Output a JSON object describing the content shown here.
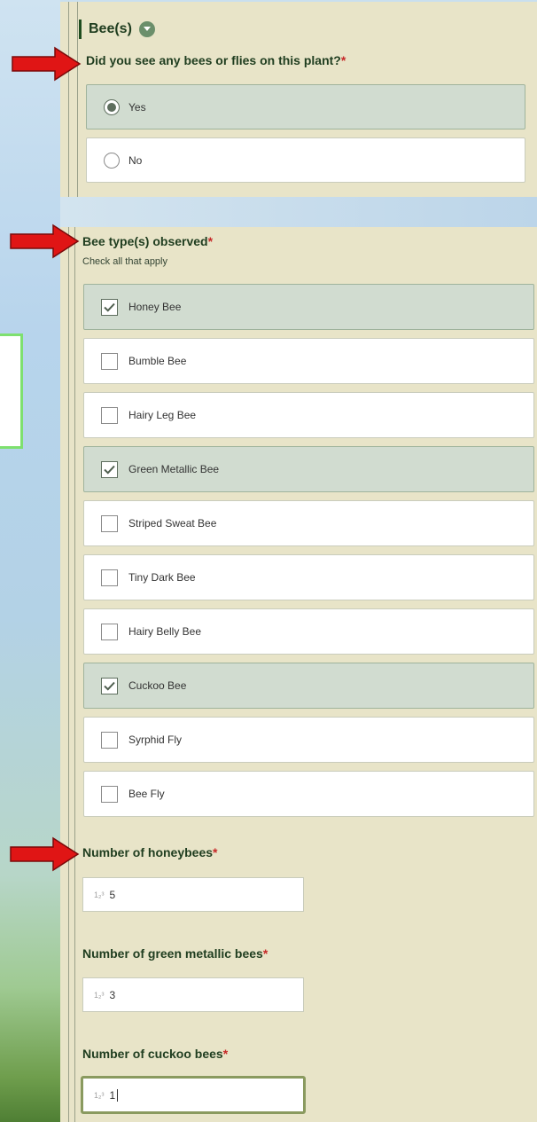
{
  "section": {
    "title": "Bee(s)"
  },
  "q1": {
    "label": "Did you see any bees or flies on this plant?",
    "required_mark": "*",
    "options": [
      {
        "label": "Yes",
        "selected": true
      },
      {
        "label": "No",
        "selected": false
      }
    ]
  },
  "q2": {
    "label": "Bee type(s) observed",
    "required_mark": "*",
    "hint": "Check all that apply",
    "options": [
      {
        "label": "Honey Bee",
        "checked": true
      },
      {
        "label": "Bumble Bee",
        "checked": false
      },
      {
        "label": "Hairy Leg Bee",
        "checked": false
      },
      {
        "label": "Green Metallic Bee",
        "checked": true
      },
      {
        "label": "Striped Sweat Bee",
        "checked": false
      },
      {
        "label": "Tiny Dark Bee",
        "checked": false
      },
      {
        "label": "Hairy Belly Bee",
        "checked": false
      },
      {
        "label": "Cuckoo Bee",
        "checked": true
      },
      {
        "label": "Syrphid Fly",
        "checked": false
      },
      {
        "label": "Bee Fly",
        "checked": false
      }
    ]
  },
  "counts": [
    {
      "label": "Number of honeybees",
      "required_mark": "*",
      "value": "5"
    },
    {
      "label": "Number of green metallic bees",
      "required_mark": "*",
      "value": "3"
    },
    {
      "label": "Number of cuckoo bees",
      "required_mark": "*",
      "value": "1"
    }
  ],
  "number_icon": "1₂³",
  "colors": {
    "accent": "#1f3d1f",
    "required": "#c62828",
    "selected_bg": "#d1dcd0",
    "arrow": "#e01515"
  }
}
